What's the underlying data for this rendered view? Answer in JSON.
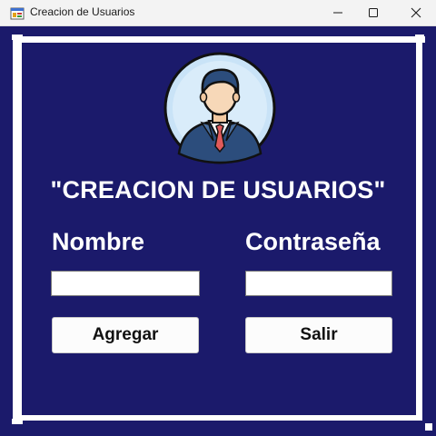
{
  "window": {
    "title": "Creacion de Usuarios",
    "icon": "app-form-icon",
    "controls": [
      "minimize-icon",
      "maximize-icon",
      "close-icon"
    ]
  },
  "form": {
    "background_color": "#1b1a6b",
    "avatar_icon": "user-avatar-icon",
    "heading": "\"CREACION DE USUARIOS\"",
    "nombre_label": "Nombre",
    "nombre_value": "",
    "contrasena_label": "Contraseña",
    "contrasena_value": "",
    "agregar_label": "Agregar",
    "salir_label": "Salir"
  }
}
